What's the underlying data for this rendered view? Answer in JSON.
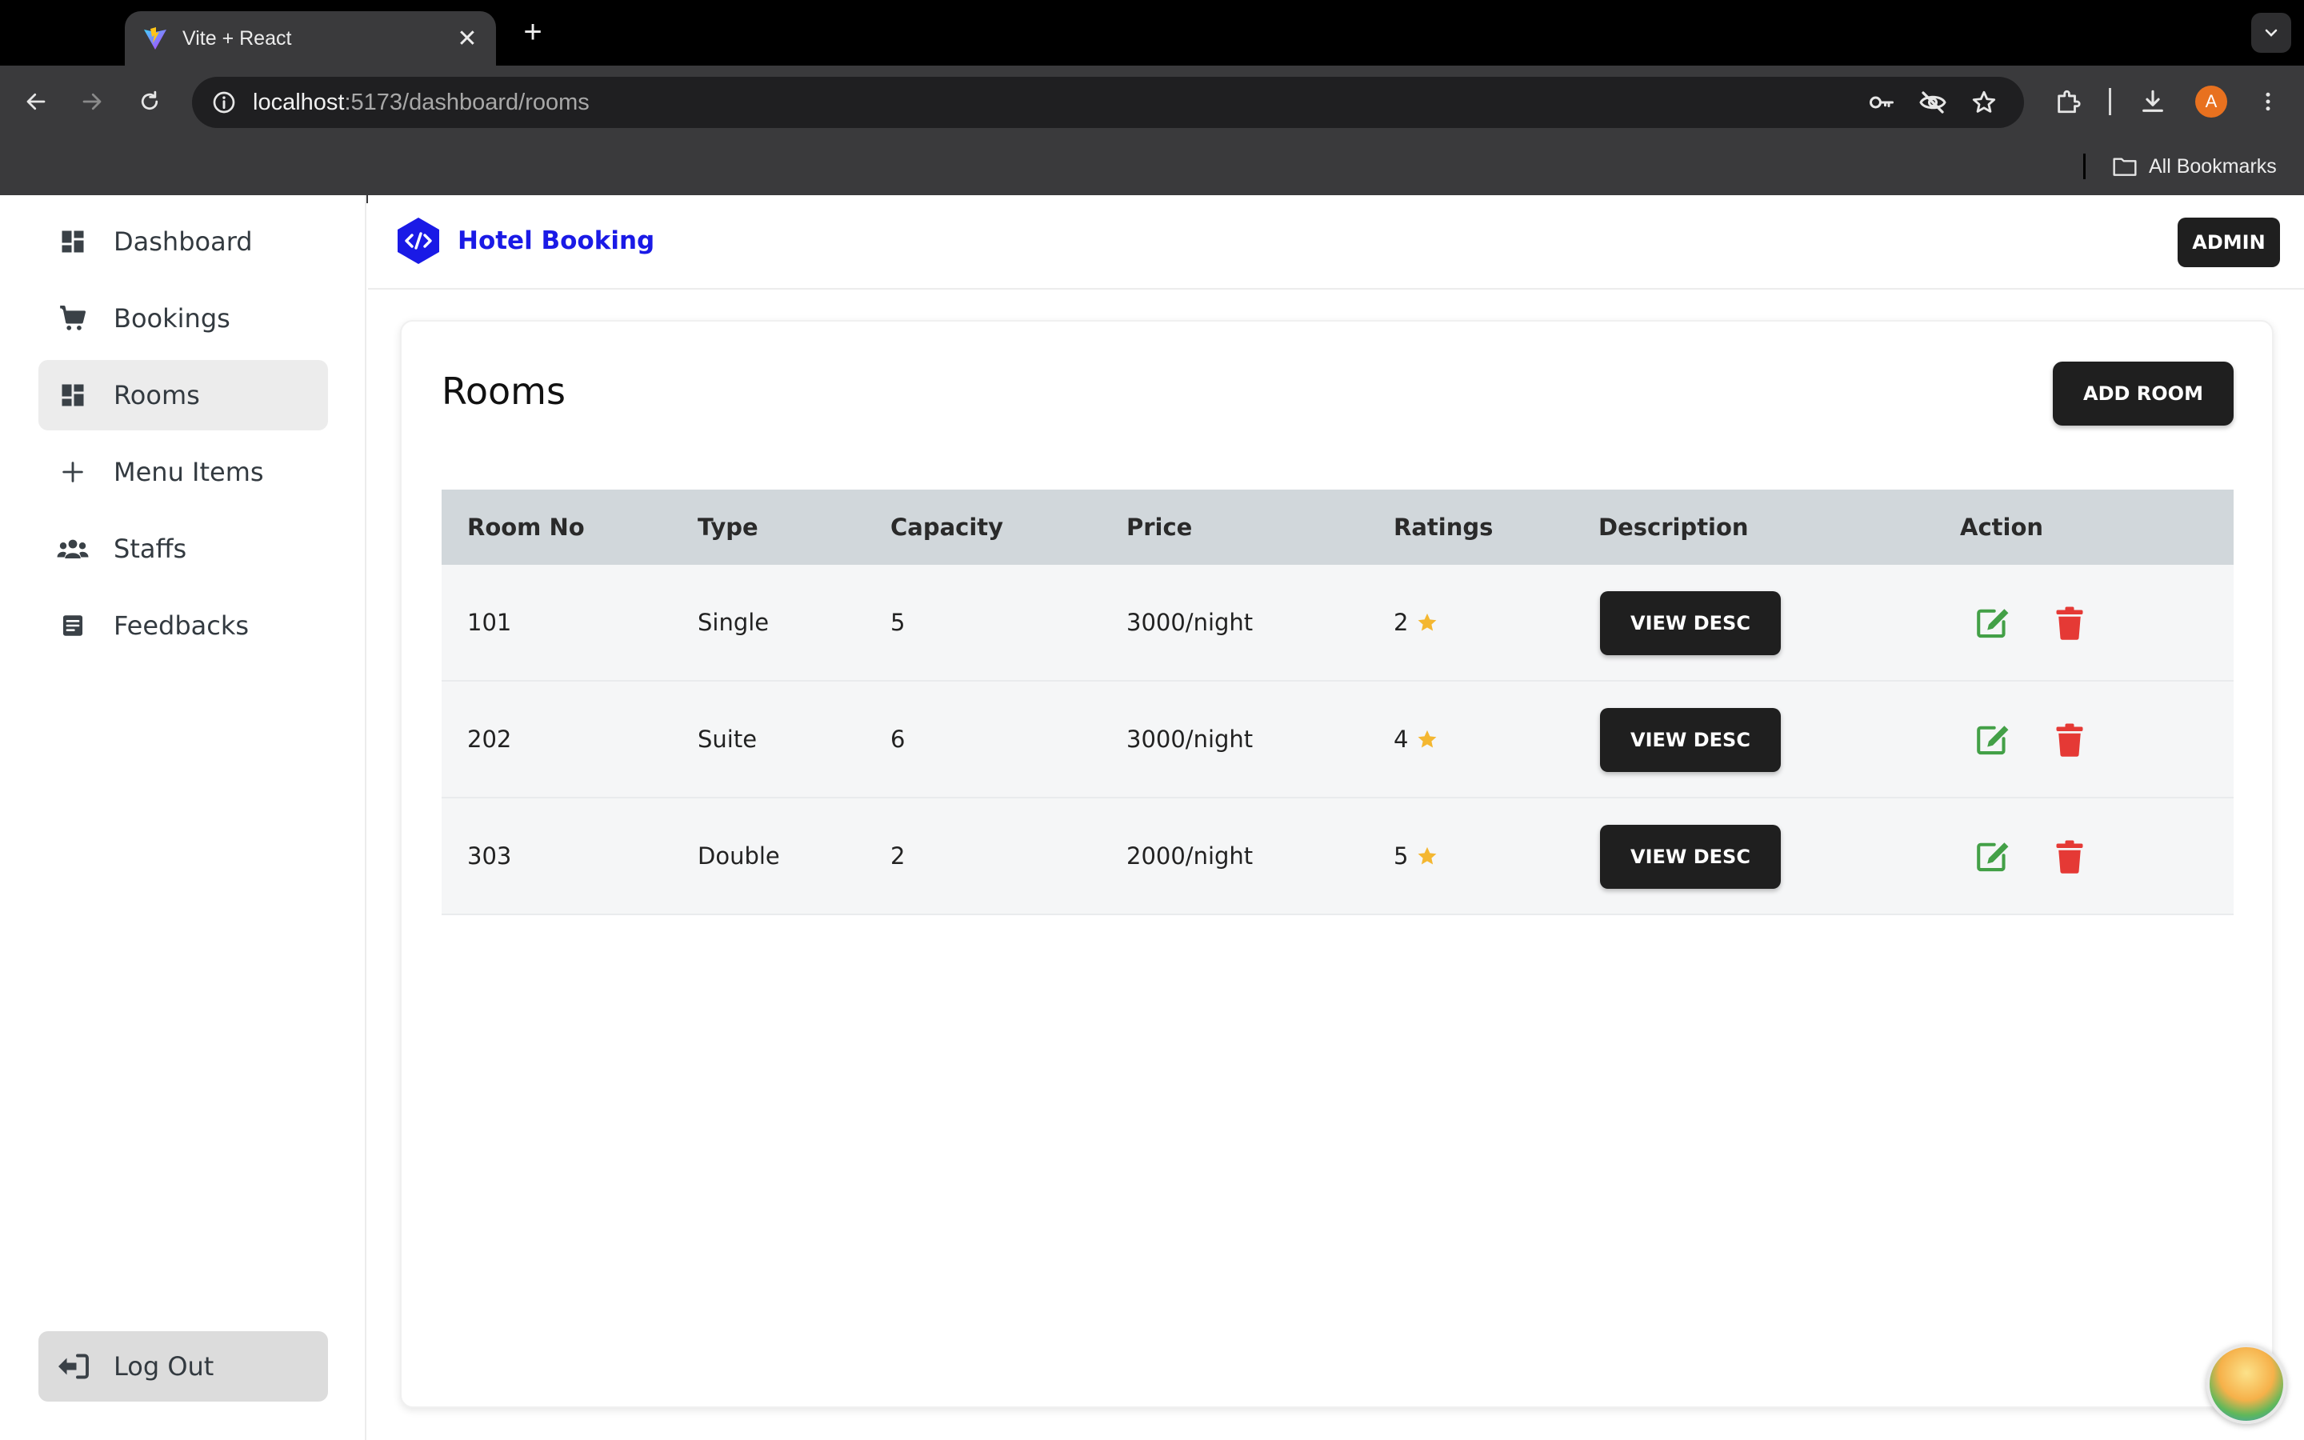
{
  "browser": {
    "tab_title": "Vite + React",
    "tab_close_glyph": "✕",
    "new_tab_glyph": "+",
    "url_host": "localhost",
    "url_path": ":5173/dashboard/rooms",
    "bookmarks_label": "All Bookmarks",
    "avatar_letter": "A"
  },
  "sidebar": {
    "items": [
      {
        "label": "Dashboard",
        "icon": "dashboard-icon"
      },
      {
        "label": "Bookings",
        "icon": "cart-icon"
      },
      {
        "label": "Rooms",
        "icon": "dashboard-icon",
        "active": true
      },
      {
        "label": "Menu Items",
        "icon": "plus-icon"
      },
      {
        "label": "Staffs",
        "icon": "people-icon"
      },
      {
        "label": "Feedbacks",
        "icon": "document-icon"
      }
    ],
    "logout_label": "Log Out"
  },
  "header": {
    "brand": "Hotel Booking",
    "admin_label": "ADMIN"
  },
  "main": {
    "title": "Rooms",
    "add_label": "ADD ROOM",
    "columns": [
      "Room No",
      "Type",
      "Capacity",
      "Price",
      "Ratings",
      "Description",
      "Action"
    ],
    "rows": [
      {
        "room_no": "101",
        "type": "Single",
        "capacity": "5",
        "price": "3000/night",
        "rating": "2",
        "desc_label": "VIEW DESC"
      },
      {
        "room_no": "202",
        "type": "Suite",
        "capacity": "6",
        "price": "3000/night",
        "rating": "4",
        "desc_label": "VIEW DESC"
      },
      {
        "room_no": "303",
        "type": "Double",
        "capacity": "2",
        "price": "2000/night",
        "rating": "5",
        "desc_label": "VIEW DESC"
      }
    ]
  },
  "colors": {
    "brand_blue": "#1a1ae6",
    "button_dark": "#1f1f1f",
    "star": "#f4b731",
    "edit_green": "#43a047",
    "delete_red": "#e53935"
  }
}
